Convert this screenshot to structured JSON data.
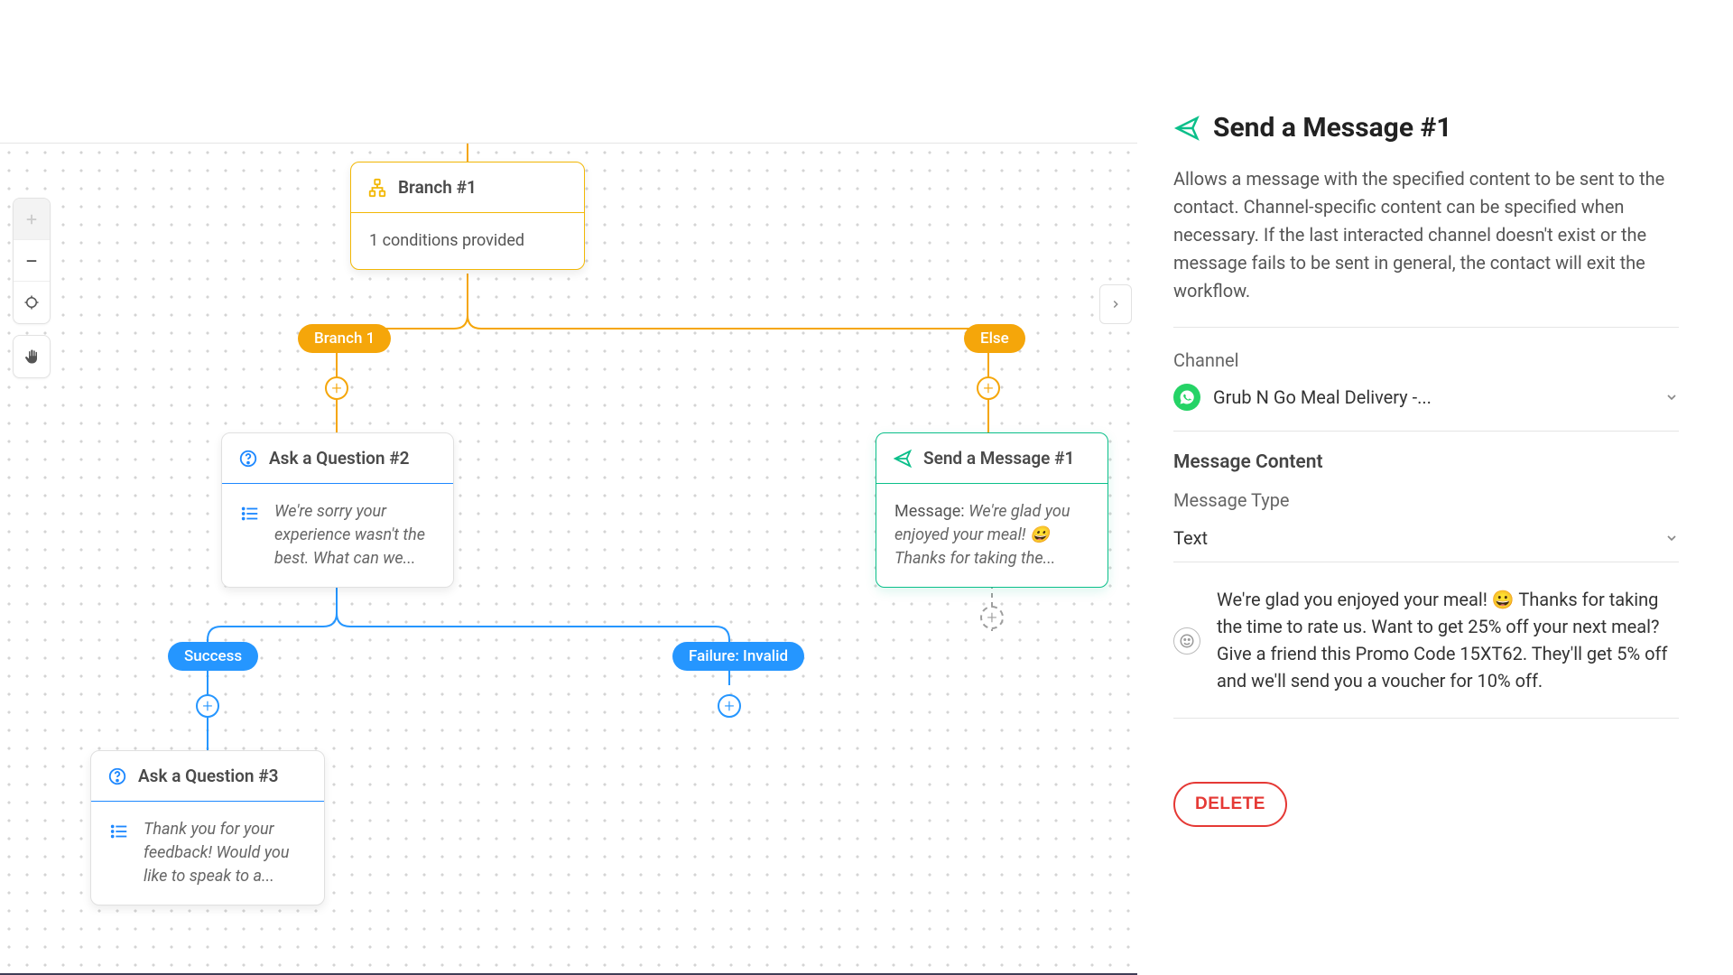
{
  "panel": {
    "title": "Send a Message #1",
    "description": "Allows a message with the specified content to be sent to the contact. Channel-specific content can be specified when necessary. If the last interacted channel doesn't exist or the message fails to be sent in general, the contact will exit the workflow.",
    "channel_label": "Channel",
    "channel_value": "Grub N Go Meal Delivery -...",
    "message_content_label": "Message Content",
    "message_type_label": "Message Type",
    "message_type_value": "Text",
    "message_body": "We're glad you enjoyed your meal! 😀 Thanks for taking the time to rate us. Want to get 25% off your next meal? Give a friend this Promo Code 15XT62. They'll get 5% off and we'll send you a voucher for 10% off.",
    "delete_label": "DELETE"
  },
  "canvas": {
    "branch_node": {
      "title": "Branch #1",
      "body": "1 conditions provided"
    },
    "ask2_node": {
      "title": "Ask a Question #2",
      "body": "We're sorry your experience wasn't the best. What can we..."
    },
    "ask3_node": {
      "title": "Ask a Question #3",
      "body": "Thank you for your feedback! Would you like to speak to a..."
    },
    "send_node": {
      "title": "Send a Message #1",
      "prefix": "Message: ",
      "body": "We're glad you enjoyed your meal! 😀 Thanks for taking the..."
    },
    "pills": {
      "branch1": "Branch 1",
      "else": "Else",
      "success": "Success",
      "failure": "Failure: Invalid"
    }
  }
}
